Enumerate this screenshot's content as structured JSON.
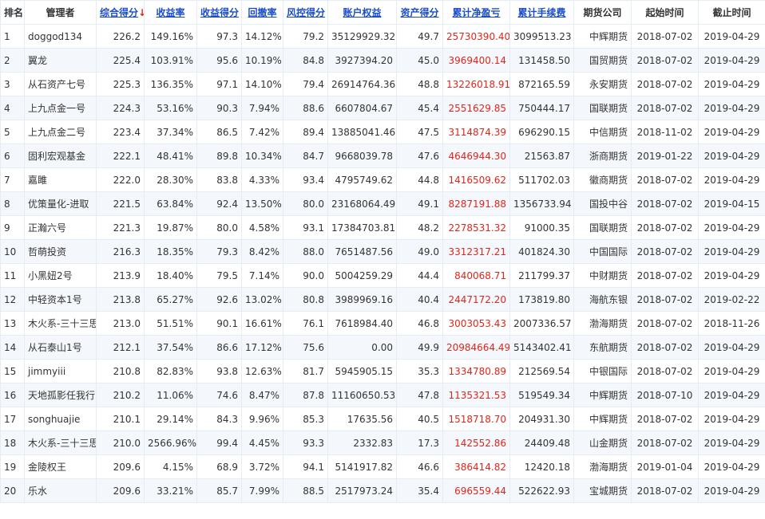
{
  "headers": {
    "rank": "排名",
    "manager": "管理者",
    "composite": "综合得分",
    "sort_arrow": "↓",
    "return_rate": "收益率",
    "return_score": "收益得分",
    "drawdown": "回撤率",
    "risk_score": "风控得分",
    "equity": "账户权益",
    "asset_score": "资产得分",
    "cum_pnl": "累计净盈亏",
    "cum_fee": "累计手续费",
    "broker": "期货公司",
    "start": "起始时间",
    "end": "截止时间"
  },
  "colors": {
    "link": "#1a4dcc",
    "pnl": "#e0261a",
    "stripe": "#f4f8fd",
    "grid": "#e4ecf4"
  },
  "rows": [
    [
      "1",
      "doggod134",
      "226.2",
      "149.16%",
      "97.3",
      "14.12%",
      "79.2",
      "35129929.32",
      "49.7",
      "25730390.40",
      "3099513.23",
      "中辉期货",
      "2018-07-02",
      "2019-04-29"
    ],
    [
      "2",
      "翼龙",
      "225.4",
      "103.91%",
      "95.6",
      "10.19%",
      "84.8",
      "3927394.20",
      "45.0",
      "3969400.14",
      "131458.50",
      "国贸期货",
      "2018-07-02",
      "2019-04-29"
    ],
    [
      "3",
      "从石资产七号",
      "225.3",
      "136.35%",
      "97.1",
      "14.10%",
      "79.4",
      "26914764.36",
      "48.8",
      "13226018.91",
      "872165.59",
      "永安期货",
      "2018-07-02",
      "2019-04-29"
    ],
    [
      "4",
      "上九点金一号",
      "224.3",
      "53.16%",
      "90.3",
      "7.94%",
      "88.6",
      "6607804.67",
      "45.4",
      "2551629.85",
      "750444.17",
      "国联期货",
      "2018-07-02",
      "2019-04-29"
    ],
    [
      "5",
      "上九点金二号",
      "223.4",
      "37.34%",
      "86.5",
      "7.42%",
      "89.4",
      "13885041.46",
      "47.5",
      "3114874.39",
      "696290.15",
      "中信期货",
      "2018-11-02",
      "2019-04-29"
    ],
    [
      "6",
      "固利宏观基金",
      "222.1",
      "48.41%",
      "89.8",
      "10.34%",
      "84.7",
      "9668039.78",
      "47.6",
      "4646944.30",
      "21563.87",
      "浙商期货",
      "2019-01-22",
      "2019-04-29"
    ],
    [
      "7",
      "嘉雎",
      "222.0",
      "28.30%",
      "83.8",
      "4.33%",
      "93.4",
      "4795749.62",
      "44.8",
      "1416509.62",
      "511702.03",
      "徽商期货",
      "2018-07-02",
      "2019-04-29"
    ],
    [
      "8",
      "优策量化-进取",
      "221.5",
      "63.84%",
      "92.4",
      "13.50%",
      "80.0",
      "23168064.49",
      "49.1",
      "8287191.88",
      "1356733.94",
      "国投中谷",
      "2018-07-02",
      "2019-04-15"
    ],
    [
      "9",
      "正瀚六号",
      "221.3",
      "19.87%",
      "80.0",
      "4.58%",
      "93.1",
      "17384703.81",
      "48.2",
      "2278531.32",
      "91000.35",
      "国联期货",
      "2018-07-02",
      "2019-04-29"
    ],
    [
      "10",
      "哲萌投资",
      "216.3",
      "18.35%",
      "79.3",
      "8.42%",
      "88.0",
      "7651487.56",
      "49.0",
      "3312317.21",
      "401824.30",
      "中国国际",
      "2018-07-02",
      "2019-04-29"
    ],
    [
      "11",
      "小黑妞2号",
      "213.9",
      "18.40%",
      "79.5",
      "7.14%",
      "90.0",
      "5004259.29",
      "44.4",
      "840068.71",
      "211799.37",
      "中财期货",
      "2018-07-02",
      "2019-04-29"
    ],
    [
      "12",
      "中轻资本1号",
      "213.8",
      "65.27%",
      "92.6",
      "13.02%",
      "80.8",
      "3989969.16",
      "40.4",
      "2447172.20",
      "173819.80",
      "海航东银",
      "2018-07-02",
      "2019-02-22"
    ],
    [
      "13",
      "木火系-三十三思",
      "213.0",
      "51.51%",
      "90.1",
      "16.61%",
      "76.1",
      "7618984.40",
      "46.8",
      "3003053.43",
      "2007336.57",
      "渤海期货",
      "2018-07-02",
      "2018-11-26"
    ],
    [
      "14",
      "从石泰山1号",
      "212.1",
      "37.54%",
      "86.6",
      "17.12%",
      "75.6",
      "0.00",
      "49.9",
      "20984664.49",
      "5143402.41",
      "东航期货",
      "2018-07-02",
      "2019-04-29"
    ],
    [
      "15",
      "jimmyiii",
      "210.8",
      "82.83%",
      "93.8",
      "12.63%",
      "81.7",
      "5945905.15",
      "35.3",
      "1334780.89",
      "212569.54",
      "中银国际",
      "2018-07-02",
      "2019-04-29"
    ],
    [
      "16",
      "天地孤影任我行",
      "210.2",
      "11.06%",
      "74.6",
      "8.47%",
      "87.8",
      "11160650.53",
      "47.8",
      "1135321.53",
      "519549.34",
      "中辉期货",
      "2018-07-10",
      "2019-04-29"
    ],
    [
      "17",
      "songhuajie",
      "210.1",
      "29.14%",
      "84.3",
      "9.96%",
      "85.3",
      "17635.56",
      "40.5",
      "1518718.70",
      "204931.30",
      "中辉期货",
      "2018-07-02",
      "2019-04-29"
    ],
    [
      "18",
      "木火系-三十三思",
      "210.0",
      "2566.96%",
      "99.4",
      "4.45%",
      "93.3",
      "2332.83",
      "17.3",
      "142552.86",
      "24409.48",
      "山金期货",
      "2018-07-02",
      "2019-04-29"
    ],
    [
      "19",
      "金陵权王",
      "209.6",
      "4.15%",
      "68.9",
      "3.72%",
      "94.1",
      "5141917.82",
      "46.6",
      "386414.82",
      "12420.18",
      "渤海期货",
      "2019-01-04",
      "2019-04-29"
    ],
    [
      "20",
      "乐水",
      "209.6",
      "33.21%",
      "85.7",
      "7.99%",
      "88.5",
      "2517973.24",
      "35.4",
      "696559.44",
      "522622.93",
      "宝城期货",
      "2018-07-02",
      "2019-04-29"
    ]
  ]
}
